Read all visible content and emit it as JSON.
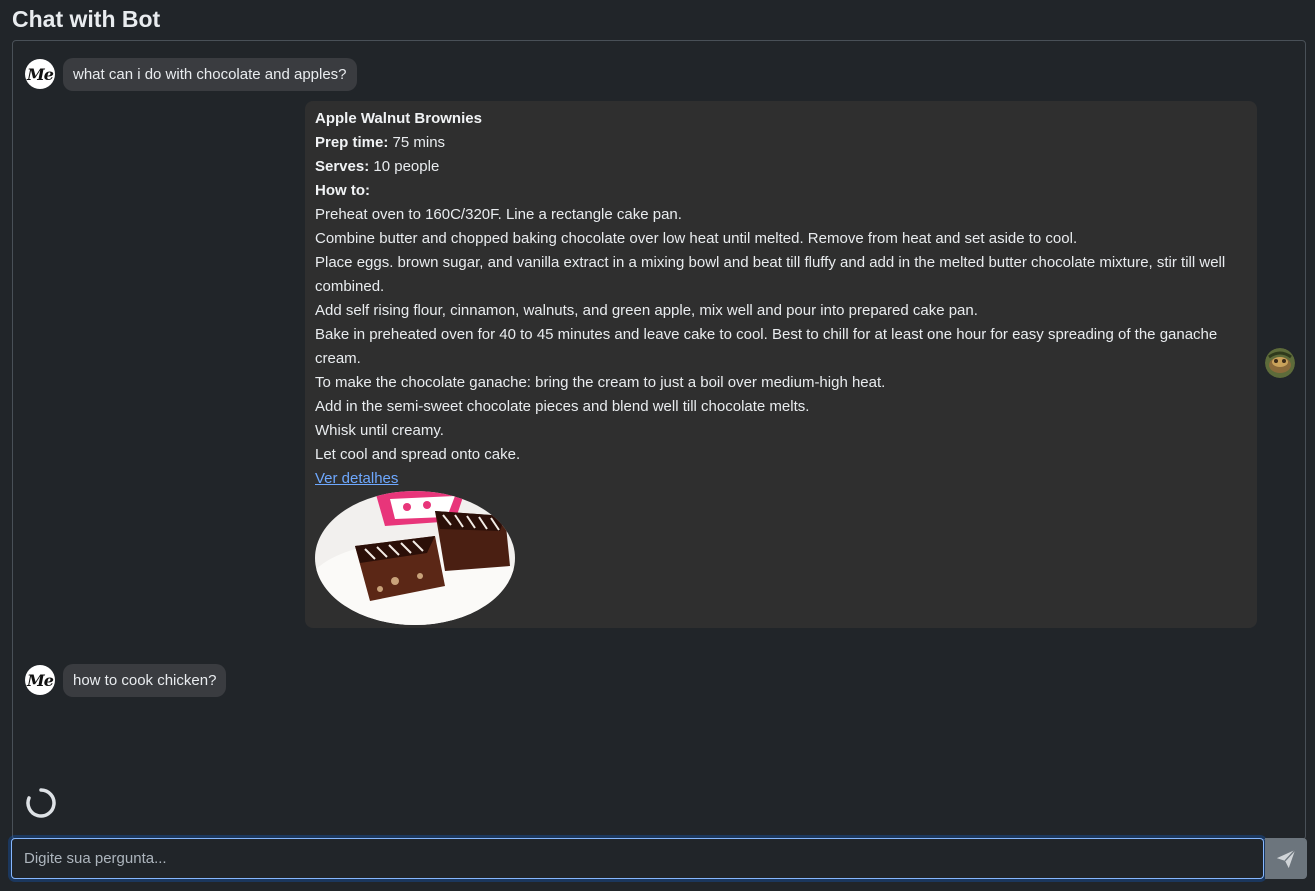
{
  "header": {
    "title": "Chat with Bot"
  },
  "messages": {
    "user1": {
      "avatar_text": "Me",
      "text": "what can i do with chocolate and apples?"
    },
    "bot1": {
      "title": "Apple Walnut Brownies",
      "prep_label": "Prep time:",
      "prep_value": "75 mins",
      "serves_label": "Serves:",
      "serves_value": "10 people",
      "howto_label": "How to:",
      "steps": [
        "Preheat oven to 160C/320F. Line a rectangle cake pan.",
        "Combine butter and chopped baking chocolate over low heat until melted. Remove from heat and set aside to cool.",
        "Place eggs. brown sugar, and vanilla extract in a mixing bowl and beat till fluffy and add in the melted butter chocolate mixture, stir till well combined.",
        "Add self rising flour, cinnamon, walnuts, and green apple, mix well and pour into prepared cake pan.",
        "Bake in preheated oven for 40 to 45 minutes and leave cake to cool. Best to chill for at least one hour for easy spreading of the ganache cream.",
        "To make the chocolate ganache: bring the cream to just a boil over medium-high heat.",
        "Add in the semi-sweet chocolate pieces and blend well till chocolate melts.",
        "Whisk until creamy.",
        "Let cool and spread onto cake."
      ],
      "link_text": "Ver detalhes"
    },
    "user2": {
      "avatar_text": "Me",
      "text": "how to cook chicken?"
    }
  },
  "input": {
    "placeholder": "Digite sua pergunta..."
  },
  "icons": {
    "send": "send-icon",
    "loading": "spinner-icon",
    "user_avatar": "user-avatar-icon",
    "bot_avatar": "bot-avatar-icon"
  },
  "colors": {
    "background": "#212529",
    "bubble_user": "#3a3c40",
    "bubble_bot": "#2f2f2f",
    "link": "#6ea8fe",
    "send_button": "#6c757d",
    "input_focus": "#86b7fe"
  }
}
